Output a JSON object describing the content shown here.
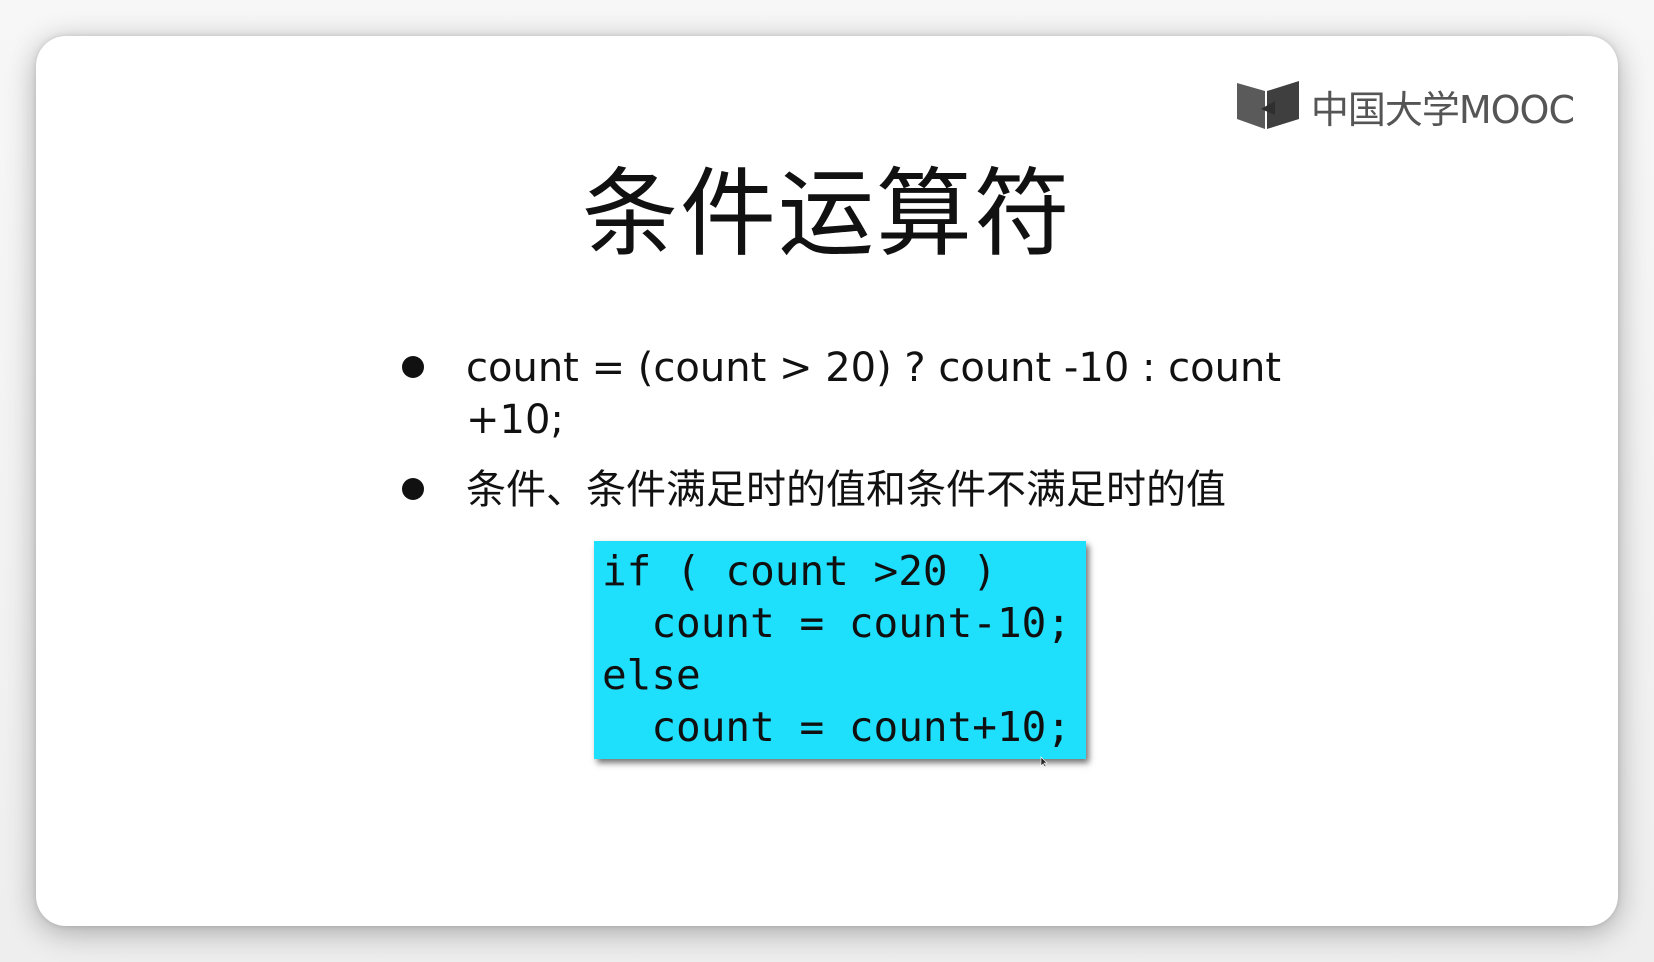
{
  "logo": {
    "icon": "book-icon",
    "text": "中国大学MOOC"
  },
  "slide": {
    "title": "条件运算符",
    "bullets": [
      {
        "text": "count = (count > 20) ? count -10 : count +10;"
      },
      {
        "text": "条件、条件满足时的值和条件不满足时的值"
      }
    ],
    "code": {
      "lines": [
        "if ( count >20 )",
        "  count = count-10;",
        "else",
        "  count = count+10;"
      ],
      "background": "#1ee0fc"
    }
  }
}
